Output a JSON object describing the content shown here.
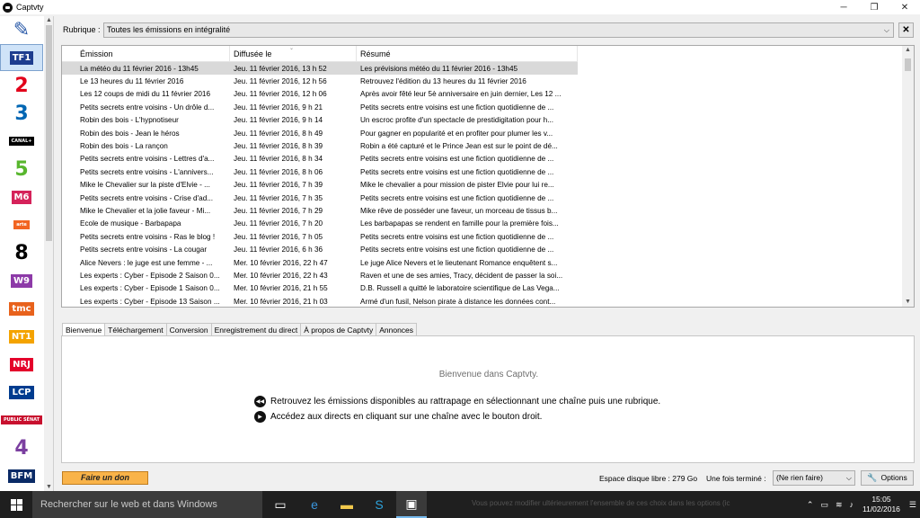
{
  "window": {
    "title": "Captvty",
    "minimize": "─",
    "maximize": "❐",
    "close": "✕"
  },
  "channels": [
    {
      "name": "tools",
      "label": "✎",
      "color": "#2a5aa8"
    },
    {
      "name": "tf1",
      "label": "TF1",
      "color": "#1e3d8f"
    },
    {
      "name": "france2",
      "label": "2",
      "color": "#e2001a"
    },
    {
      "name": "france3",
      "label": "3",
      "color": "#0066b3"
    },
    {
      "name": "canal-plus",
      "label": "CANAL+",
      "color": "#000000"
    },
    {
      "name": "france5",
      "label": "5",
      "color": "#58b62e"
    },
    {
      "name": "m6",
      "label": "M6",
      "color": "#d5225a"
    },
    {
      "name": "arte",
      "label": "arte",
      "color": "#f26522"
    },
    {
      "name": "d8",
      "label": "8",
      "color": "#000000"
    },
    {
      "name": "w9",
      "label": "W9",
      "color": "#8d3aa8"
    },
    {
      "name": "tmc",
      "label": "tmc",
      "color": "#e8621c"
    },
    {
      "name": "nt1",
      "label": "NT1",
      "color": "#f4a300"
    },
    {
      "name": "nrj12",
      "label": "NRJ",
      "color": "#e4002b"
    },
    {
      "name": "lcp",
      "label": "LCP",
      "color": "#003c8f"
    },
    {
      "name": "public-senat",
      "label": "PUBLIC SÉNAT",
      "color": "#c8102e"
    },
    {
      "name": "france4",
      "label": "4",
      "color": "#7b3fa0"
    },
    {
      "name": "bfm",
      "label": "BFM",
      "color": "#0a2a66"
    }
  ],
  "rubrique": {
    "label": "Rubrique :",
    "value": "Toutes les émissions en intégralité",
    "chevron": "⌵",
    "clear": "✕"
  },
  "table": {
    "columns": [
      "Émission",
      "Diffusée le",
      "Résumé"
    ],
    "sort_indicator": "⌄",
    "rows": [
      [
        "La météo du 11 février 2016 - 13h45",
        "Jeu. 11 février 2016, 13 h 52",
        "Les prévisions météo du 11 février 2016 - 13h45"
      ],
      [
        "Le 13 heures du 11 février 2016",
        "Jeu. 11 février 2016, 12 h 56",
        "Retrouvez l'édition du 13 heures du 11 février 2016"
      ],
      [
        "Les 12 coups de midi du 11 février 2016",
        "Jeu. 11 février 2016, 12 h 06",
        "Après avoir fêté leur 5è anniversaire en juin dernier, Les 12 ..."
      ],
      [
        "Petits secrets entre voisins - Un drôle d...",
        "Jeu. 11 février 2016, 9 h 21",
        "Petits secrets entre voisins est une fiction quotidienne de ..."
      ],
      [
        "Robin des bois - L'hypnotiseur",
        "Jeu. 11 février 2016, 9 h 14",
        "Un escroc profite d'un spectacle de prestidigitation pour h..."
      ],
      [
        "Robin des bois - Jean le héros",
        "Jeu. 11 février 2016, 8 h 49",
        "Pour gagner en popularité et en profiter pour plumer les v..."
      ],
      [
        "Robin des bois - La rançon",
        "Jeu. 11 février 2016, 8 h 39",
        "Robin a été capturé et le Prince Jean est sur le point de dé..."
      ],
      [
        "Petits secrets entre voisins - Lettres d'a...",
        "Jeu. 11 février 2016, 8 h 34",
        "Petits secrets entre voisins est une fiction quotidienne de ..."
      ],
      [
        "Petits secrets entre voisins - L'annivers...",
        "Jeu. 11 février 2016, 8 h 06",
        "Petits secrets entre voisins est une fiction quotidienne de ..."
      ],
      [
        "Mike le Chevalier sur la piste d'Elvie - ...",
        "Jeu. 11 février 2016, 7 h 39",
        "Mike le chevalier a pour mission de pister Elvie pour lui re..."
      ],
      [
        "Petits secrets entre voisins - Crise d'ad...",
        "Jeu. 11 février 2016, 7 h 35",
        "Petits secrets entre voisins est une fiction quotidienne de ..."
      ],
      [
        "Mike le Chevalier et la jolie faveur - Mi...",
        "Jeu. 11 février 2016, 7 h 29",
        "Mike rêve de posséder une faveur, un morceau de tissus b..."
      ],
      [
        "Ecole de musique - Barbapapa",
        "Jeu. 11 février 2016, 7 h 20",
        "Les barbapapas se rendent en famille pour la première fois..."
      ],
      [
        "Petits secrets entre voisins - Ras le blog !",
        "Jeu. 11 février 2016, 7 h 05",
        "Petits secrets entre voisins est une fiction quotidienne de ..."
      ],
      [
        "Petits secrets entre voisins - La cougar",
        "Jeu. 11 février 2016, 6 h 36",
        "Petits secrets entre voisins est une fiction quotidienne de ..."
      ],
      [
        "Alice Nevers : le juge est une femme - ...",
        "Mer. 10 février 2016, 22 h 47",
        "Le juge Alice Nevers et le lieutenant Romance enquêtent s..."
      ],
      [
        "Les experts : Cyber - Episode 2 Saison 0...",
        "Mer. 10 février 2016, 22 h 43",
        "Raven et une de ses amies, Tracy, décident de passer la soi..."
      ],
      [
        "Les experts : Cyber - Episode 1 Saison 0...",
        "Mer. 10 février 2016, 21 h 55",
        "D.B. Russell a quitté le laboratoire scientifique de Las Vega..."
      ],
      [
        "Les experts : Cyber - Episode 13 Saison ...",
        "Mer. 10 février 2016, 21 h 03",
        "Armé d'un fusil, Nelson pirate à distance les données cont..."
      ]
    ]
  },
  "tabs": [
    "Bienvenue",
    "Téléchargement",
    "Conversion",
    "Enregistrement du direct",
    "À propos de Captvty",
    "Annonces"
  ],
  "welcome": {
    "title": "Bienvenue dans Captvty.",
    "hint1": "Retrouvez les émissions disponibles au rattrapage en sélectionnant une chaîne puis une rubrique.",
    "hint2": "Accédez aux directs en cliquant sur une chaîne avec le bouton droit.",
    "hint1_icon": "◀◀",
    "hint2_icon": "▶"
  },
  "footer": {
    "donate": "Faire un don",
    "disk": "Espace disque libre : 279 Go",
    "once_done_label": "Une fois terminé :",
    "once_done_value": "(Ne rien faire)",
    "options": "Options",
    "wrench": "🔧"
  },
  "taskbar": {
    "search_placeholder": "Rechercher sur le web et dans Windows",
    "notice": "Vous pouvez modifier ultérieurement l'ensemble de ces choix dans les options (ic",
    "time": "15:05",
    "date": "11/02/2016",
    "tray_up": "⌃",
    "tray_battery": "▭",
    "tray_network": "≋",
    "tray_volume": "♪",
    "tray_notifications": "☰"
  }
}
